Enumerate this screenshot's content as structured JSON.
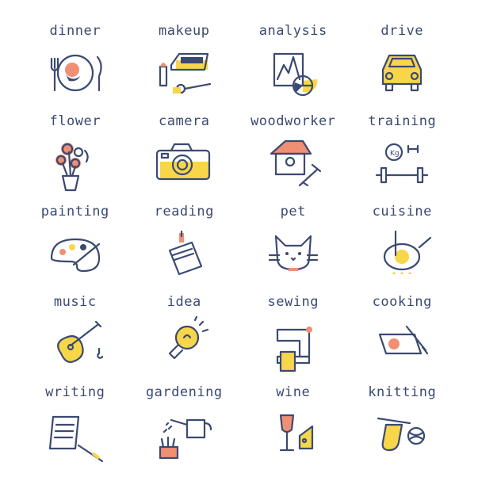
{
  "colors": {
    "ink": "#3b4a72",
    "yellow": "#f7d64a",
    "coral": "#f08f73"
  },
  "icons": [
    {
      "label": "dinner",
      "icon": "dinner-icon"
    },
    {
      "label": "makeup",
      "icon": "makeup-icon"
    },
    {
      "label": "analysis",
      "icon": "analysis-icon"
    },
    {
      "label": "drive",
      "icon": "drive-icon"
    },
    {
      "label": "flower",
      "icon": "flower-icon"
    },
    {
      "label": "camera",
      "icon": "camera-icon"
    },
    {
      "label": "woodworker",
      "icon": "woodworker-icon"
    },
    {
      "label": "training",
      "icon": "training-icon"
    },
    {
      "label": "painting",
      "icon": "painting-icon"
    },
    {
      "label": "reading",
      "icon": "reading-icon"
    },
    {
      "label": "pet",
      "icon": "pet-icon"
    },
    {
      "label": "cuisine",
      "icon": "cuisine-icon"
    },
    {
      "label": "music",
      "icon": "music-icon"
    },
    {
      "label": "idea",
      "icon": "idea-icon"
    },
    {
      "label": "sewing",
      "icon": "sewing-icon"
    },
    {
      "label": "cooking",
      "icon": "cooking-icon"
    },
    {
      "label": "writing",
      "icon": "writing-icon"
    },
    {
      "label": "gardening",
      "icon": "gardening-icon"
    },
    {
      "label": "wine",
      "icon": "wine-icon"
    },
    {
      "label": "knitting",
      "icon": "knitting-icon"
    }
  ]
}
